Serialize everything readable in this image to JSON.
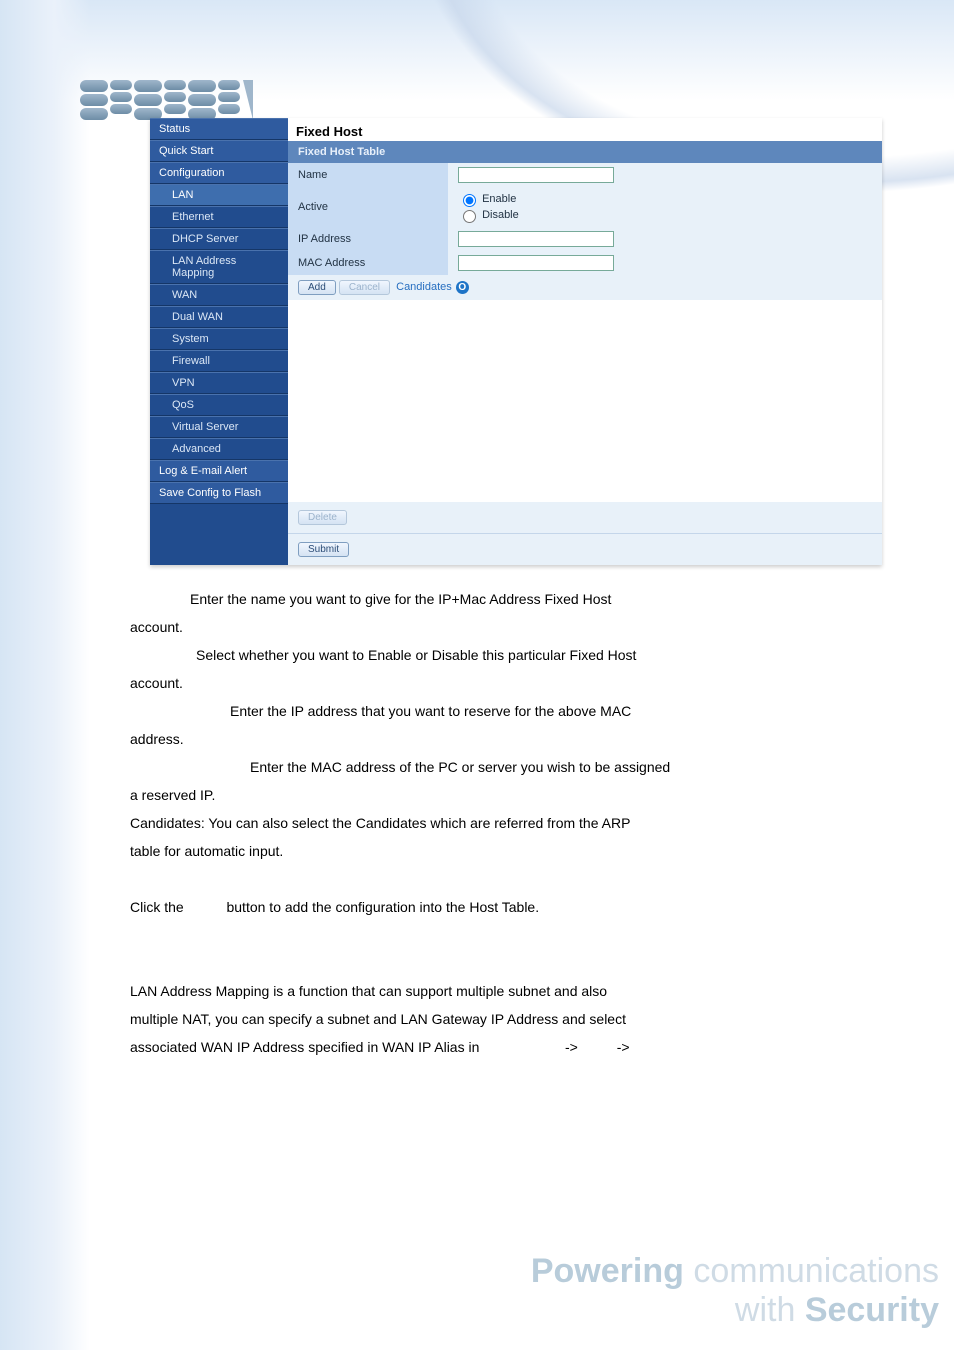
{
  "app": {
    "logo_alt": "BILLION"
  },
  "sidebar": {
    "status": "Status",
    "quick": "Quick Start",
    "config": "Configuration",
    "lan": "LAN",
    "ethernet": "Ethernet",
    "dhcp": "DHCP Server",
    "lanmap": "LAN Address Mapping",
    "wan": "WAN",
    "dualwan": "Dual WAN",
    "system": "System",
    "firewall": "Firewall",
    "vpn": "VPN",
    "qos": "QoS",
    "vserver": "Virtual Server",
    "advanced": "Advanced",
    "log": "Log & E-mail Alert",
    "save": "Save Config to Flash"
  },
  "panel": {
    "title": "Fixed Host",
    "table_title": "Fixed Host Table",
    "name": "Name",
    "active": "Active",
    "enable": "Enable",
    "disable": "Disable",
    "ip": "IP Address",
    "mac": "MAC Address",
    "add": "Add",
    "cancel": "Cancel",
    "candidates": "Candidates",
    "delete": "Delete",
    "submit": "Submit"
  },
  "doc": {
    "p1a": "Enter the name you want to give for the IP+Mac Address Fixed Host",
    "p1b": "account.",
    "p2a": "Select whether you want to Enable or Disable this particular Fixed Host",
    "p2b": "account.",
    "p3a": "Enter the IP address that you want to reserve for the above MAC",
    "p3b": "address.",
    "p4a": "Enter the MAC address of the PC or server you wish to be assigned",
    "p4b": "a reserved IP.",
    "p5": "Candidates: You can also select the Candidates which are referred from the ARP",
    "p5b": "table for automatic input.",
    "p6a": "Click the",
    "p6b": "button to add the configuration into the Host Table.",
    "p7": "LAN Address Mapping is a function that can support multiple subnet and also",
    "p7b": "multiple NAT, you can specify a subnet and LAN Gateway IP Address and select",
    "p7c1": "associated WAN IP Address specified in WAN IP Alias in",
    "arrow": "->"
  },
  "tagline": {
    "word1": "Powering",
    "word2": "communications",
    "word3": "with",
    "word4": "Security"
  }
}
